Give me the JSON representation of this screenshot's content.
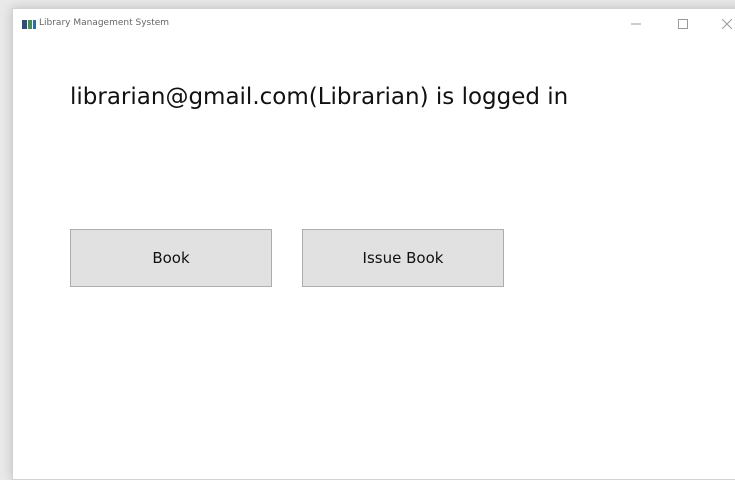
{
  "window": {
    "title": "Library Management System"
  },
  "main": {
    "status_text": "librarian@gmail.com(Librarian) is logged in",
    "book_button_label": "Book",
    "issue_book_button_label": "Issue Book"
  },
  "icons": {
    "app": "app-icon",
    "minimize": "minimize-icon",
    "maximize": "maximize-icon",
    "close": "close-icon"
  },
  "colors": {
    "button_face": "#e1e1e1",
    "button_border": "#adadad",
    "window_bg": "#ffffff"
  }
}
